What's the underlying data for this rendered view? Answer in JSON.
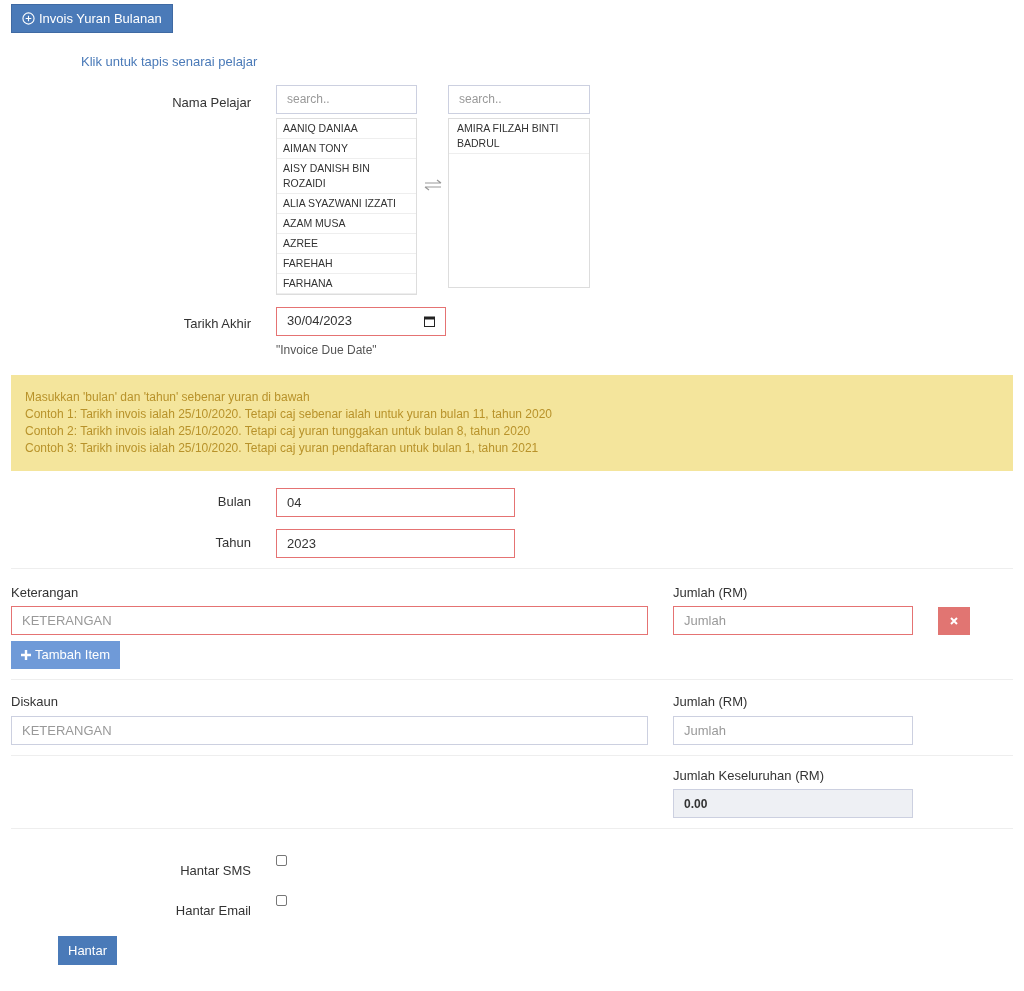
{
  "header_button": {
    "label": "Invois Yuran Bulanan"
  },
  "filter_link": "Klik untuk tapis senarai pelajar",
  "student_picker": {
    "label": "Nama Pelajar",
    "available": {
      "placeholder": "search..",
      "items": [
        "AANIQ DANIAA",
        "AIMAN TONY",
        "AISY DANISH BIN ROZAIDI",
        "ALIA SYAZWANI IZZATI",
        "AZAM MUSA",
        "AZREE",
        "FAREHAH",
        "FARHANA"
      ]
    },
    "chosen": {
      "placeholder": "search..",
      "items": [
        "AMIRA FILZAH BINTI BADRUL"
      ]
    }
  },
  "due_date": {
    "label": "Tarikh Akhir",
    "value": "30/04/2023",
    "invalid": true,
    "hint": "\"Invoice Due Date\""
  },
  "notice": [
    "Masukkan 'bulan' dan 'tahun' sebenar yuran di bawah",
    "Contoh 1: Tarikh invois ialah 25/10/2020. Tetapi caj sebenar ialah untuk yuran bulan 11, tahun 2020",
    "Contoh 2: Tarikh invois ialah 25/10/2020. Tetapi caj yuran tunggakan untuk bulan 8, tahun 2020",
    "Contoh 3: Tarikh invois ialah 25/10/2020. Tetapi caj yuran pendaftaran untuk bulan 1, tahun 2021"
  ],
  "period_fields": [
    {
      "label": "Bulan",
      "value": "04",
      "invalid": true
    },
    {
      "label": "Tahun",
      "value": "2023",
      "invalid": true
    }
  ],
  "items": [
    {
      "description": {
        "label": "Keterangan",
        "placeholder": "KETERANGAN",
        "invalid": true
      },
      "amount": {
        "label": "Jumlah (RM)",
        "placeholder": "Jumlah",
        "invalid": true
      }
    }
  ],
  "add_item_button": "Tambah Item",
  "discount": {
    "description": {
      "label": "Diskaun",
      "placeholder": "KETERANGAN",
      "invalid": false
    },
    "amount": {
      "label": "Jumlah (RM)",
      "placeholder": "Jumlah",
      "invalid": false
    }
  },
  "total": {
    "label": "Jumlah Keseluruhan (RM)",
    "value": "0.00"
  },
  "options": [
    {
      "label": "Hantar SMS",
      "checked": false
    },
    {
      "label": "Hantar Email",
      "checked": false
    }
  ],
  "submit_button": "Hantar"
}
